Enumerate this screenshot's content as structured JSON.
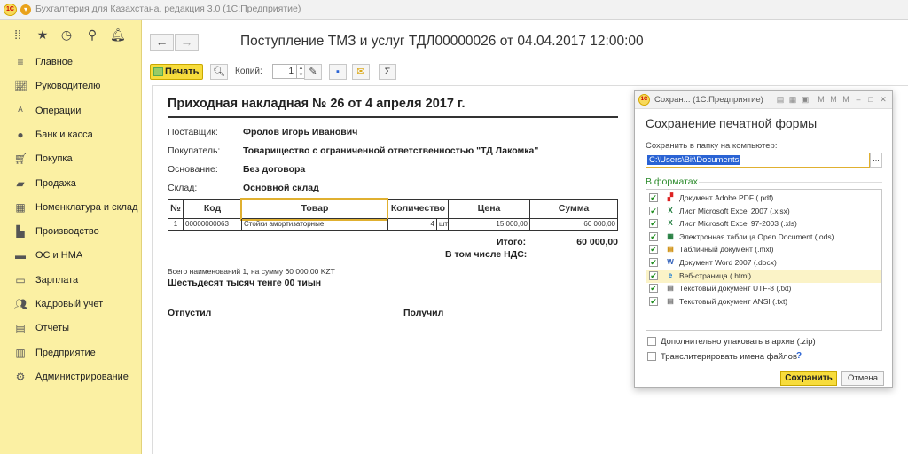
{
  "app": {
    "title": "Бухгалтерия для Казахстана, редакция 3.0  (1С:Предприятие)"
  },
  "sidebar": {
    "items": [
      {
        "label": "Главное",
        "icon": "menu-icon"
      },
      {
        "label": "Руководителю",
        "icon": "chart-line-icon"
      },
      {
        "label": "Операции",
        "icon": "operations-icon"
      },
      {
        "label": "Банк и касса",
        "icon": "coins-icon"
      },
      {
        "label": "Покупка",
        "icon": "cart-icon"
      },
      {
        "label": "Продажа",
        "icon": "bag-icon"
      },
      {
        "label": "Номенклатура и склад",
        "icon": "grid-icon"
      },
      {
        "label": "Производство",
        "icon": "factory-icon"
      },
      {
        "label": "ОС и НМА",
        "icon": "truck-icon"
      },
      {
        "label": "Зарплата",
        "icon": "wallet-icon"
      },
      {
        "label": "Кадровый учет",
        "icon": "people-icon"
      },
      {
        "label": "Отчеты",
        "icon": "report-icon"
      },
      {
        "label": "Предприятие",
        "icon": "building-icon"
      },
      {
        "label": "Администрирование",
        "icon": "gear-icon"
      }
    ]
  },
  "document": {
    "title": "Поступление ТМЗ и услуг ТДЛ00000026 от 04.04.2017 12:00:00",
    "toolbar": {
      "print_label": "Печать",
      "copies_label": "Копий:",
      "copies_value": "1"
    }
  },
  "invoice": {
    "heading": "Приходная накладная № 26 от 4 апреля 2017 г.",
    "fields": [
      {
        "label": "Поставщик:",
        "value": "Фролов Игорь Иванович"
      },
      {
        "label": "Покупатель:",
        "value": "Товарищество с ограниченной ответственностью \"ТД Лакомка\""
      },
      {
        "label": "Основание:",
        "value": "Без договора"
      },
      {
        "label": "Склад:",
        "value": "Основной склад"
      }
    ],
    "table": {
      "headers": [
        "№",
        "Код",
        "Товар",
        "Количество",
        "Цена",
        "Сумма"
      ],
      "rows": [
        {
          "no": "1",
          "code": "00000000063",
          "item": "Стойки амортизаторные",
          "qty": "4",
          "unit": "шт",
          "price": "15 000,00",
          "sum": "60 000,00"
        }
      ]
    },
    "total_label": "Итого:",
    "total_value": "60 000,00",
    "vat_label": "В том числе НДС:",
    "summary": "Всего наименований 1, на сумму 60 000,00 KZT",
    "amount_words": "Шестьдесят тысяч тенге 00 тиын",
    "released_label": "Отпустил",
    "received_label": "Получил"
  },
  "dialog": {
    "window_title": "Сохран...  (1С:Предприятие)",
    "title": "Сохранение печатной формы",
    "folder_label": "Сохранить в папку на компьютер:",
    "folder_value": "C:\\Users\\Bit\\Documents",
    "browse_label": "...",
    "formats_label": "В форматах",
    "formats": [
      {
        "label": "Документ Adobe PDF (.pdf)",
        "checked": true,
        "icon": "pdf-icon"
      },
      {
        "label": "Лист Microsoft Excel 2007 (.xlsx)",
        "checked": true,
        "icon": "excel-icon"
      },
      {
        "label": "Лист Microsoft Excel 97-2003 (.xls)",
        "checked": true,
        "icon": "excel-icon"
      },
      {
        "label": "Электронная таблица Open Document (.ods)",
        "checked": true,
        "icon": "ods-icon"
      },
      {
        "label": "Табличный документ (.mxl)",
        "checked": true,
        "icon": "mxl-icon"
      },
      {
        "label": "Документ Word 2007 (.docx)",
        "checked": true,
        "icon": "word-icon"
      },
      {
        "label": "Веб-страница (.html)",
        "checked": true,
        "icon": "ie-icon"
      },
      {
        "label": "Текстовый документ UTF-8 (.txt)",
        "checked": true,
        "icon": "txt-icon"
      },
      {
        "label": "Текстовый документ ANSI (.txt)",
        "checked": true,
        "icon": "txt-icon"
      }
    ],
    "zip_label": "Дополнительно упаковать в архив (.zip)",
    "translit_label": "Транслитерировать имена файлов",
    "help_label": "?",
    "save_label": "Сохранить",
    "cancel_label": "Отмена"
  }
}
